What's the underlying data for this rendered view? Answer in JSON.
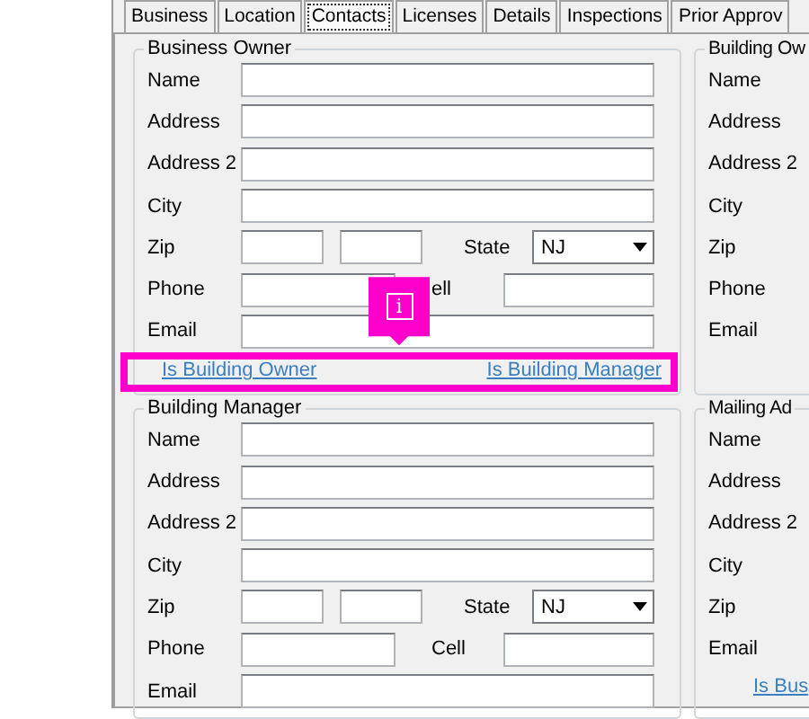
{
  "tabs": [
    {
      "label": "Business",
      "selected": false
    },
    {
      "label": "Location",
      "selected": false
    },
    {
      "label": "Contacts",
      "selected": true
    },
    {
      "label": "Licenses",
      "selected": false
    },
    {
      "label": "Details",
      "selected": false
    },
    {
      "label": "Inspections",
      "selected": false
    },
    {
      "label": "Prior Approv",
      "selected": false
    }
  ],
  "main_groups": [
    {
      "title": "Business Owner",
      "rows": [
        {
          "kind": "text",
          "label": "Name"
        },
        {
          "kind": "text",
          "label": "Address"
        },
        {
          "kind": "text",
          "label": "Address 2"
        },
        {
          "kind": "text",
          "label": "City"
        },
        {
          "kind": "zip",
          "label": "Zip",
          "state_label": "State",
          "state_value": "NJ"
        },
        {
          "kind": "phone",
          "label": "Phone",
          "cell_label": "ell"
        },
        {
          "kind": "text",
          "label": "Email"
        }
      ],
      "links": [
        "Is Building Owner",
        "Is Building Manager"
      ]
    },
    {
      "title": "Building Manager",
      "rows": [
        {
          "kind": "text",
          "label": "Name"
        },
        {
          "kind": "text",
          "label": "Address"
        },
        {
          "kind": "text",
          "label": "Address 2"
        },
        {
          "kind": "text",
          "label": "City"
        },
        {
          "kind": "zip",
          "label": "Zip",
          "state_label": "State",
          "state_value": "NJ"
        },
        {
          "kind": "phone",
          "label": "Phone",
          "cell_label": "Cell"
        },
        {
          "kind": "text",
          "label": "Email"
        }
      ]
    }
  ],
  "side_groups": [
    {
      "title": "Building Ow",
      "labels": [
        "Name",
        "Address",
        "Address 2",
        "City",
        "Zip",
        "Phone",
        "Email"
      ]
    },
    {
      "title": "Mailing Ad",
      "labels": [
        "Name",
        "Address",
        "Address 2",
        "City",
        "Zip",
        "Email"
      ],
      "link": "Is Bus"
    }
  ],
  "callout": {
    "glyph": "i"
  }
}
